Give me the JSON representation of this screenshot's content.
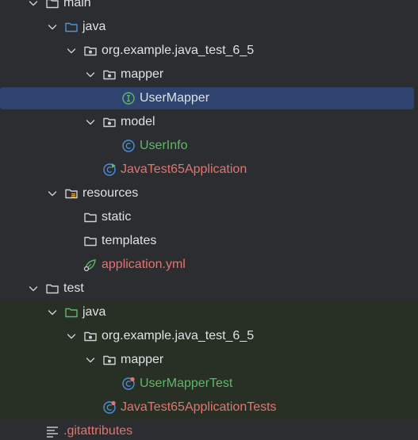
{
  "tree": [
    {
      "label": "main",
      "icon": "folder-icon",
      "chevron": "chevron-down-icon",
      "color": "default",
      "depth": 0
    },
    {
      "label": "java",
      "icon": "source-folder-icon",
      "chevron": "chevron-down-icon",
      "color": "default",
      "depth": 1
    },
    {
      "label": "org.example.java_test_6_5",
      "icon": "package-icon",
      "chevron": "chevron-down-icon",
      "color": "default",
      "depth": 2
    },
    {
      "label": "mapper",
      "icon": "package-icon",
      "chevron": "chevron-down-icon",
      "color": "default",
      "depth": 3
    },
    {
      "label": "UserMapper",
      "icon": "interface-icon",
      "chevron": "",
      "color": "default",
      "depth": 4,
      "selected": true
    },
    {
      "label": "model",
      "icon": "package-icon",
      "chevron": "chevron-down-icon",
      "color": "default",
      "depth": 3
    },
    {
      "label": "UserInfo",
      "icon": "class-icon",
      "chevron": "",
      "color": "green",
      "depth": 4
    },
    {
      "label": "JavaTest65Application",
      "icon": "spring-boot-class-icon",
      "chevron": "",
      "color": "red",
      "depth": 3
    },
    {
      "label": "resources",
      "icon": "resources-folder-icon",
      "chevron": "chevron-down-icon",
      "color": "default",
      "depth": 1
    },
    {
      "label": "static",
      "icon": "folder-icon",
      "chevron": "",
      "color": "default",
      "depth": 2
    },
    {
      "label": "templates",
      "icon": "folder-icon",
      "chevron": "",
      "color": "default",
      "depth": 2
    },
    {
      "label": "application.yml",
      "icon": "spring-config-icon",
      "chevron": "",
      "color": "red",
      "depth": 2
    },
    {
      "label": "test",
      "icon": "folder-icon",
      "chevron": "chevron-down-icon",
      "color": "default",
      "depth": 0
    },
    {
      "label": "java",
      "icon": "test-source-folder-icon",
      "chevron": "chevron-down-icon",
      "color": "default",
      "depth": 1
    },
    {
      "label": "org.example.java_test_6_5",
      "icon": "package-icon",
      "chevron": "chevron-down-icon",
      "color": "default",
      "depth": 2
    },
    {
      "label": "mapper",
      "icon": "package-icon",
      "chevron": "chevron-down-icon",
      "color": "default",
      "depth": 3
    },
    {
      "label": "UserMapperTest",
      "icon": "test-class-icon",
      "chevron": "",
      "color": "green",
      "depth": 4
    },
    {
      "label": "JavaTest65ApplicationTests",
      "icon": "test-class-icon",
      "chevron": "",
      "color": "red",
      "depth": 3
    },
    {
      "label": ".gitattributes",
      "icon": "text-file-icon",
      "chevron": "",
      "color": "red",
      "depth": 0
    }
  ],
  "colors": {
    "background": "#2b2d30",
    "selection": "#2e436e",
    "test_region": "#283026",
    "text_default": "#dfe1e5",
    "text_green": "#5fb865",
    "text_red": "#e0766f",
    "folder_blue": "#4a90e2",
    "folder_green": "#5fb865",
    "icon_class": "#4a90e2",
    "icon_interface": "#5fb865"
  }
}
